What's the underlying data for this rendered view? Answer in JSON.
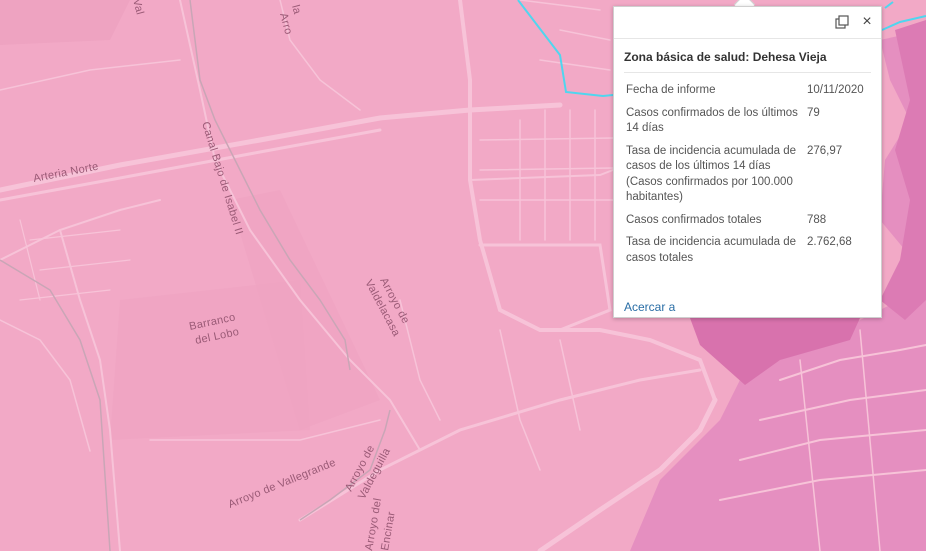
{
  "map": {
    "labels": {
      "arteria_norte": "Arteria Norte",
      "canal": "Canal Bajo de Isabel II",
      "barranco_1": "Barranco",
      "barranco_2": "del Lobo",
      "valdelacasa_1": "Arroyo de",
      "valdelacasa_2": "Valdelacasa",
      "vallegrande": "Arroyo de Vallegrande",
      "valdeguilla_1": "Arroyo de",
      "valdeguilla_2": "Valdeguilla",
      "encinar_1": "Arroyo del",
      "encinar_2": "Encinar",
      "top_1": "Arro",
      "top_2": "la",
      "top_3": "Val"
    },
    "colors": {
      "base_zone": "#f2a9c6",
      "high_zone": "#e58fc0",
      "higher_zone": "#d872ad",
      "boundary": "#4fd6ef",
      "roads": "#f7c3d8"
    }
  },
  "popup": {
    "title": "Zona básica de salud: Dehesa Vieja",
    "dock_icon": "dock-icon",
    "close_icon": "close-icon",
    "close_glyph": "×",
    "rows": [
      {
        "label": "Fecha de informe",
        "value": "10/11/2020"
      },
      {
        "label": "Casos confirmados de los últimos 14 días",
        "value": "79"
      },
      {
        "label": "Tasa de incidencia acumulada de casos de los últimos 14 días (Casos confirmados por 100.000 habitantes)",
        "value": "276,97"
      },
      {
        "label": "Casos confirmados totales",
        "value": "788"
      },
      {
        "label": "Tasa de incidencia acumulada de casos totales",
        "value": "2.762,68"
      }
    ],
    "zoom_link": "Acercar a"
  }
}
